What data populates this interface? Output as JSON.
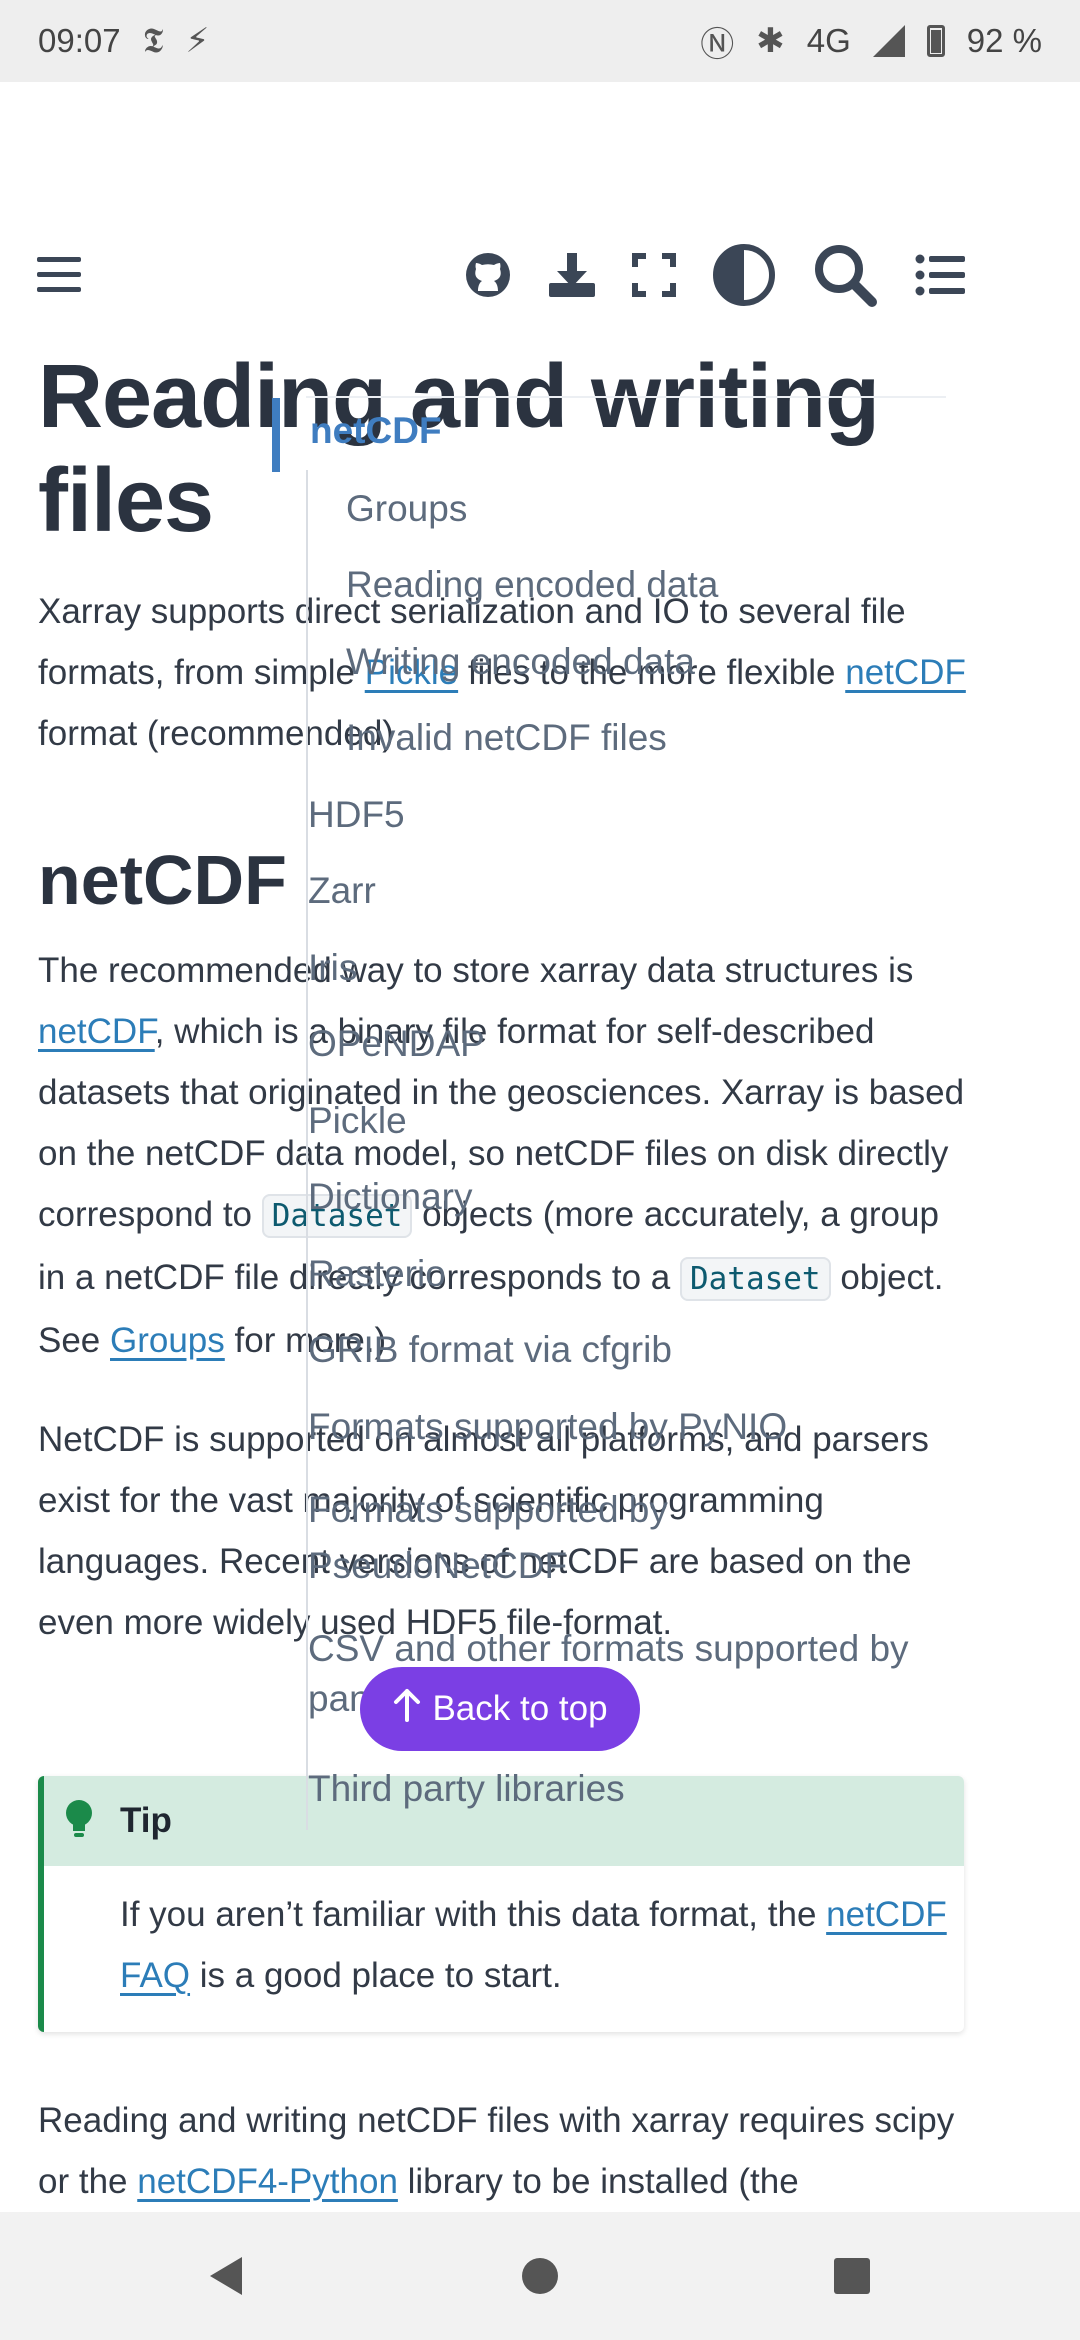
{
  "status_bar": {
    "time": "09:07",
    "network": "4G",
    "battery": "92 %"
  },
  "header": {
    "icons": [
      "menu-icon",
      "github-icon",
      "download-icon",
      "fullscreen-icon",
      "theme-toggle-icon",
      "search-icon",
      "toc-list-icon"
    ]
  },
  "article": {
    "title": "Reading and writing files",
    "intro": {
      "pre": "Xarray supports direct serialization and IO to several file formats, from simple ",
      "link1": "Pickle",
      "mid": " files to the more flexible ",
      "link2": "netCDF",
      "post": " format (recommended)."
    },
    "section_title": "netCDF",
    "para1": {
      "link_netcdf": "netCDF",
      "text1": ", which is a binary file format for self-described datasets that originated in the geosciences. Xarray is based on the netCDF data model, so netCDF files on disk directly correspond to ",
      "pre": "The recommended way to store xarray data structures is ",
      "code1": "Dataset",
      "text2": " objects (more accurately, a group in a netCDF file directly corresponds to a ",
      "code2": "Dataset",
      "text3": " object. See ",
      "link_groups": "Groups",
      "text4": " for more.)"
    },
    "para2": "NetCDF is supported on almost all platforms, and parsers exist for the vast majority of scientific programming languages. Recent versions of netCDF are based on the even more widely used HDF5 file-format.",
    "tip": {
      "title": "Tip",
      "pre": "If you aren’t familiar with this data format, the ",
      "link": "netCDF FAQ",
      "post": " is a good place to start."
    },
    "para3": {
      "pre": "Reading and writing netCDF files with xarray requires scipy or the ",
      "link": "netCDF4-Python",
      "post": " library to be installed (the"
    }
  },
  "toc": {
    "items": [
      "netCDF",
      "Groups",
      "Reading encoded data",
      "Writing encoded data",
      "Invalid netCDF files",
      "HDF5",
      "Zarr",
      "Iris",
      "OPeNDAP",
      "Pickle",
      "Dictionary",
      "Rasterio",
      "GRIB format via cfgrib",
      "Formats supported by PyNIO",
      "Formats supported by PseudoNetCDF",
      "CSV and other formats supported by pandas",
      "Third party libraries"
    ]
  },
  "back_to_top": "Back to top",
  "colors": {
    "link": "#2c7db8",
    "accent": "#7b3fe4",
    "tip_header": "#d4ebe0",
    "tip_border": "#1b8a4a"
  }
}
